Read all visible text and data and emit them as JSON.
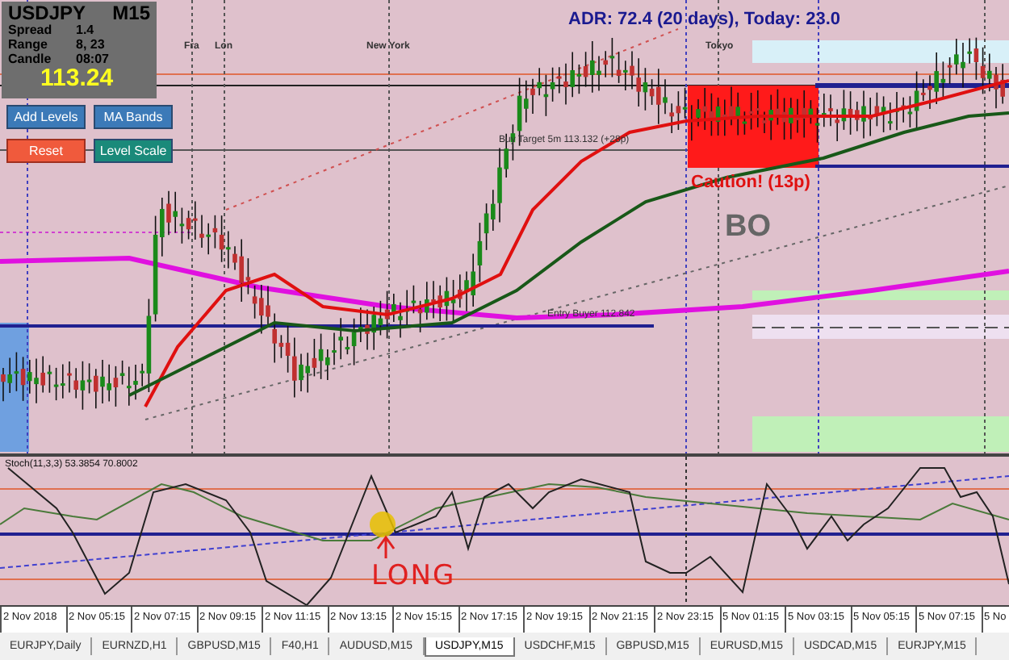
{
  "info_panel": {
    "symbol": "USDJPY",
    "timeframe": "M15",
    "rows": [
      {
        "label": "Spread",
        "value": "1.4"
      },
      {
        "label": "Range",
        "value": "8, 23"
      },
      {
        "label": "Candle",
        "value": "08:07"
      }
    ],
    "price": "113.24"
  },
  "buttons": [
    {
      "label": "Add Levels",
      "kind": "blue"
    },
    {
      "label": "MA Bands",
      "kind": "blue"
    },
    {
      "label": "Reset",
      "kind": "red"
    },
    {
      "label": "Level Scale",
      "kind": "teal"
    }
  ],
  "sessions": [
    "Fra",
    "Lon",
    "New York",
    "Tokyo"
  ],
  "adr": "ADR: 72.4 (20 days), Today: 23.0",
  "buy_target": "Buy Target 5m 113.132 (+28p)",
  "caution": "Caution! (13p)",
  "box_label": "BO",
  "entry": "Entry Buyer 112.842",
  "indicator": {
    "label": "Stoch(11,3,3) 53.3854 70.8002",
    "annotation": "LONG"
  },
  "time_axis": [
    "2 Nov 2018",
    "2 Nov 05:15",
    "2 Nov 07:15",
    "2 Nov 09:15",
    "2 Nov 11:15",
    "2 Nov 13:15",
    "2 Nov 15:15",
    "2 Nov 17:15",
    "2 Nov 19:15",
    "2 Nov 21:15",
    "2 Nov 23:15",
    "5 Nov 01:15",
    "5 Nov 03:15",
    "5 Nov 05:15",
    "5 Nov 07:15",
    "5 No"
  ],
  "tabs": [
    {
      "label": "EURJPY,Daily",
      "selected": false
    },
    {
      "label": "EURNZD,H1",
      "selected": false
    },
    {
      "label": "GBPUSD,M15",
      "selected": false
    },
    {
      "label": "F40,H1",
      "selected": false
    },
    {
      "label": "AUDUSD,M15",
      "selected": false
    },
    {
      "label": "USDJPY,M15",
      "selected": true
    },
    {
      "label": "USDCHF,M15",
      "selected": false
    },
    {
      "label": "GBPUSD,M15",
      "selected": false
    },
    {
      "label": "EURUSD,M15",
      "selected": false
    },
    {
      "label": "USDCAD,M15",
      "selected": false
    },
    {
      "label": "EURJPY,M15",
      "selected": false
    }
  ]
}
